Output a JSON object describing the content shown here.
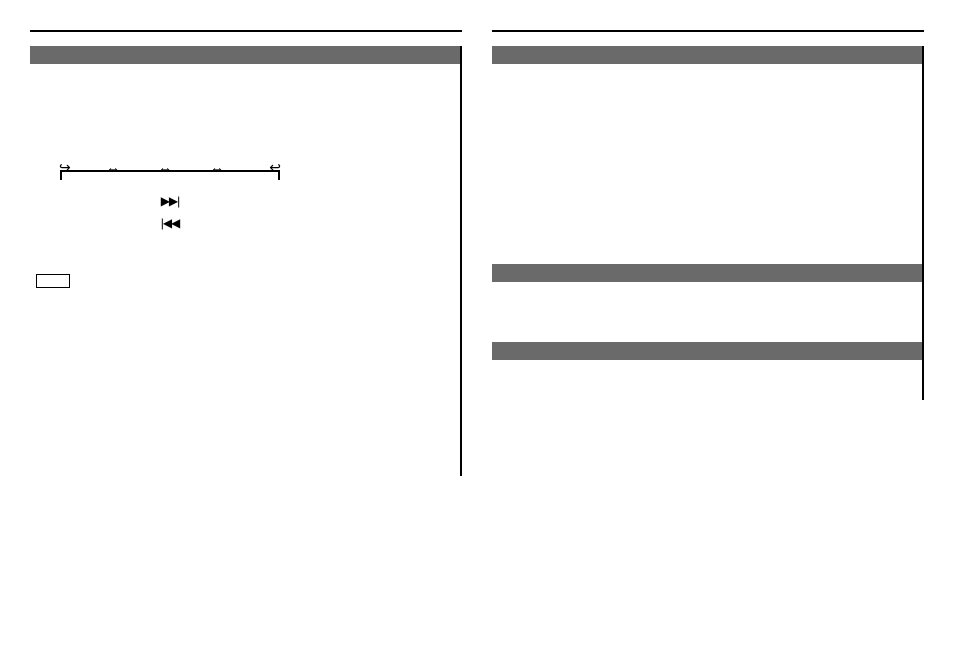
{
  "left": {
    "diagram": {
      "arrows": [
        "↪",
        "↔",
        "↔",
        "↔",
        "↩"
      ],
      "forward_glyph": "▶▶|",
      "reverse_glyph": "|◀◀"
    },
    "box_label": ""
  }
}
